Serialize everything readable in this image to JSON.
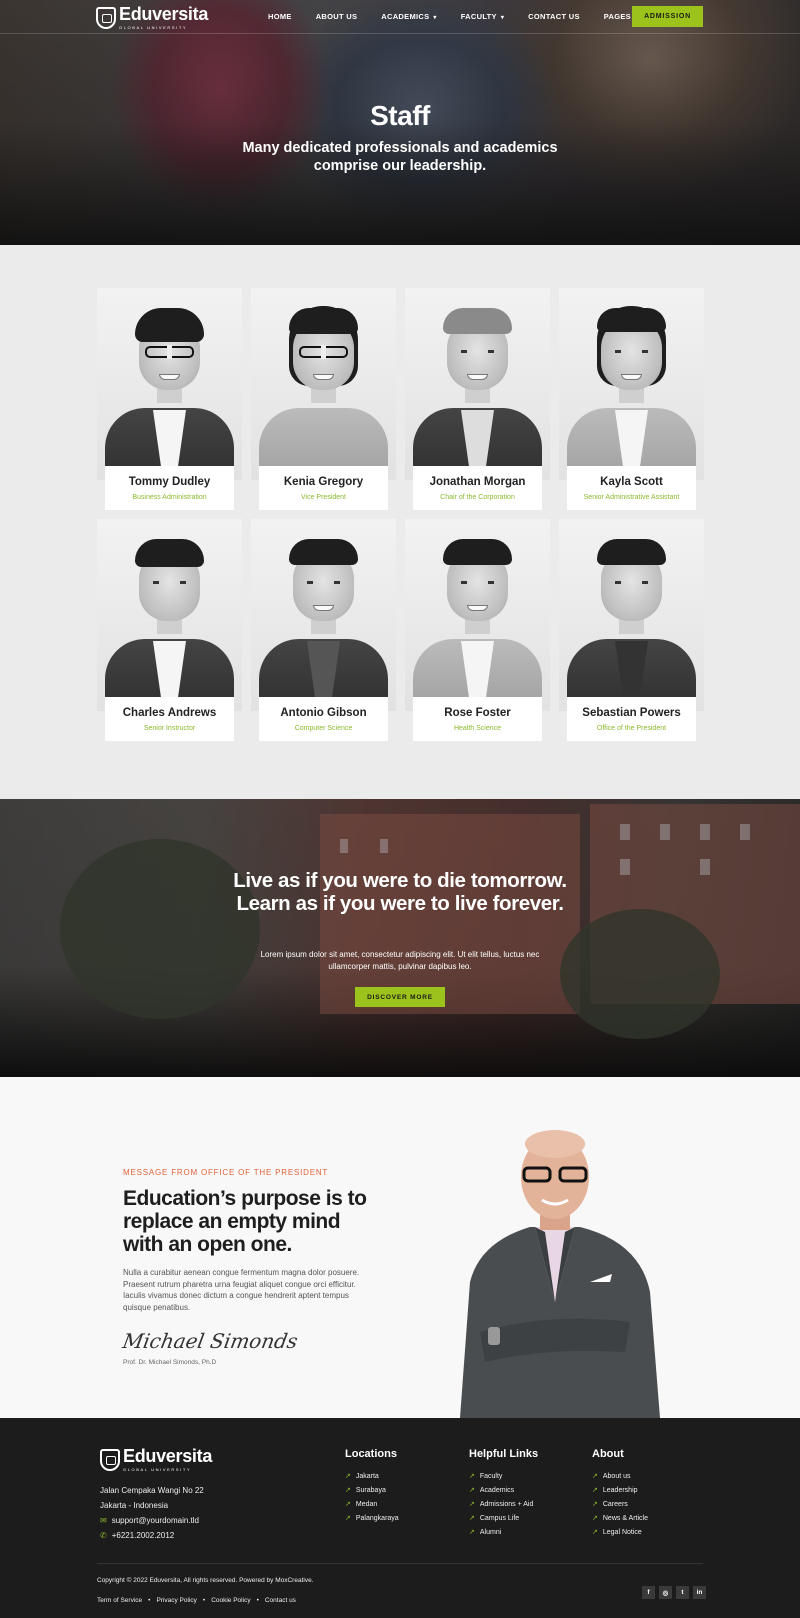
{
  "brand": {
    "name": "Eduversita",
    "tagline": "GLOBAL UNIVERSITY"
  },
  "nav": {
    "items": [
      {
        "label": "HOME"
      },
      {
        "label": "ABOUT US"
      },
      {
        "label": "ACADEMICS",
        "dropdown": true
      },
      {
        "label": "FACULTY",
        "dropdown": true
      },
      {
        "label": "CONTACT US"
      },
      {
        "label": "PAGES",
        "dropdown": true
      }
    ],
    "cta": "ADMISSION"
  },
  "hero": {
    "title": "Staff",
    "subtitle": "Many dedicated professionals and academics comprise our leadership."
  },
  "staff": [
    {
      "name": "Tommy Dudley",
      "role": "Business Administration"
    },
    {
      "name": "Kenia Gregory",
      "role": "Vice President"
    },
    {
      "name": "Jonathan Morgan",
      "role": "Chair of the Corporation"
    },
    {
      "name": "Kayla Scott",
      "role": "Senior Administrative Assistant"
    },
    {
      "name": "Charles Andrews",
      "role": "Senior Instructor"
    },
    {
      "name": "Antonio Gibson",
      "role": "Computer Science"
    },
    {
      "name": "Rose Foster",
      "role": "Health Science"
    },
    {
      "name": "Sebastian Powers",
      "role": "Office of the President"
    }
  ],
  "quote": {
    "title": "Live as if you were to die tomorrow. Learn as if you were to live forever.",
    "text": "Lorem ipsum dolor sit amet, consectetur adipiscing elit. Ut elit tellus, luctus nec ullamcorper mattis, pulvinar dapibus leo.",
    "button": "DISCOVER MORE"
  },
  "president": {
    "tag": "MESSAGE FROM OFFICE OF THE PRESIDENT",
    "title": "Education’s purpose is to replace an empty mind with an open one.",
    "text": "Nulla a curabitur aenean congue fermentum magna dolor posuere. Praesent rutrum pharetra urna feugiat aliquet congue orci efficitur. Iaculis vivamus donec dictum a congue hendrerit aptent tempus quisque penatibus.",
    "signature": "Michael Simonds",
    "name": "Prof. Dr. Michael Simonds, Ph.D"
  },
  "footer": {
    "address_line1": "Jalan Cempaka Wangi No 22",
    "address_line2": "Jakarta - Indonesia",
    "email": "support@yourdomain.tld",
    "phone": "+6221.2002.2012",
    "locations": {
      "title": "Locations",
      "items": [
        "Jakarta",
        "Surabaya",
        "Medan",
        "Palangkaraya"
      ]
    },
    "helpful": {
      "title": "Helpful Links",
      "items": [
        "Faculty",
        "Academics",
        "Admissions + Aid",
        "Campus Life",
        "Alumni"
      ]
    },
    "about": {
      "title": "About",
      "items": [
        "About us",
        "Leadership",
        "Careers",
        "News & Article",
        "Legal Notice"
      ]
    },
    "copyright": "Copyright © 2022 Eduversita, All rights reserved. Powered by MoxCreative.",
    "legal": [
      "Term of Service",
      "Privacy Policy",
      "Cookie Policy",
      "Contact us"
    ],
    "social": [
      "facebook-icon",
      "instagram-icon",
      "twitter-icon",
      "linkedin-icon"
    ]
  },
  "colors": {
    "accent": "#9bc31c",
    "tag": "#e0623a",
    "footer_bg": "#1c1c1c"
  }
}
